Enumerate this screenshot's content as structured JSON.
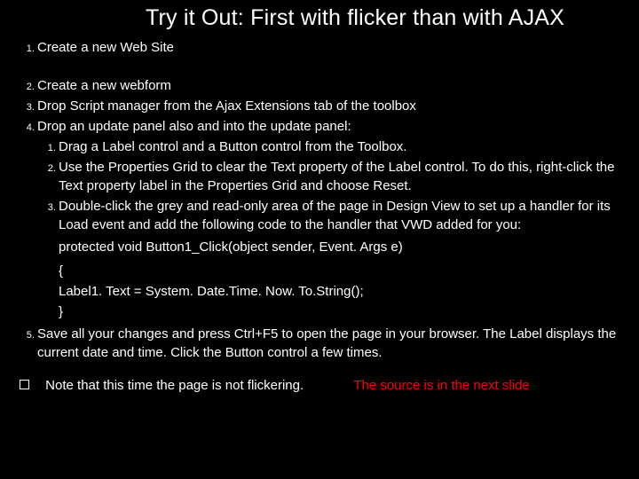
{
  "title": "Try it Out: First with flicker than with AJAX",
  "items": {
    "i1": "Create a new Web Site",
    "i2": "Create a new webform",
    "i3": "Drop Script manager from the Ajax Extensions tab of the toolbox",
    "i4": "Drop an update panel also and into the update panel:",
    "i5": "Save all your changes and press Ctrl+F5 to open the page in your browser. The Label displays the current date and time. Click the Button control a few times."
  },
  "sub": {
    "s1": "Drag a Label control and a Button control from the Toolbox.",
    "s2": "Use the Properties Grid to clear the Text property of the Label control. To do this, right-click the Text property label in the Properties Grid and choose Reset.",
    "s3": "Double-click the grey and read-only area of the page in Design View to set up a handler for its Load event and add the following code to the handler that VWD added for you:"
  },
  "code": {
    "l1": "protected void Button1_Click(object sender, Event. Args e)",
    "l2": "{",
    "l3": "Label1. Text = System. Date.Time. Now. To.String();",
    "l4": "}"
  },
  "note": {
    "left": "Note that this time the page is not flickering.",
    "right": "The source is in the next slide"
  }
}
